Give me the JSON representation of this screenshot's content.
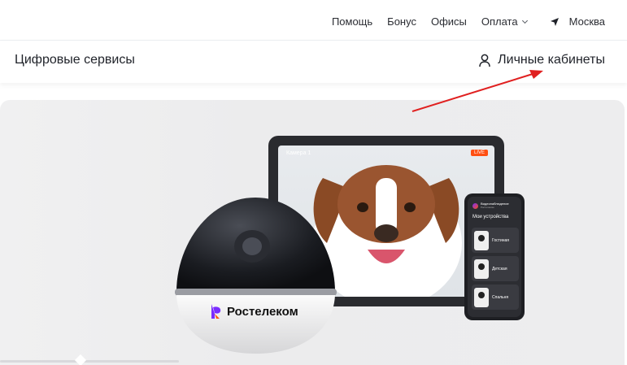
{
  "topnav": {
    "help": "Помощь",
    "bonus": "Бонус",
    "offices": "Офисы",
    "payment": "Оплата",
    "city": "Москва"
  },
  "header": {
    "title": "Цифровые сервисы",
    "cabinets": "Личные кабинеты"
  },
  "annotation": {
    "arrow_color": "#e02020"
  },
  "banner": {
    "tablet": {
      "camera_label": "Камера 1",
      "live_badge": "LIVE"
    },
    "phone": {
      "app_name": "Видеонаблюдение",
      "app_sub": "Ростелеком",
      "title": "Мои устройства",
      "devices": [
        "Гостиная",
        "Детская",
        "Спальня"
      ]
    },
    "camera_logo": "Ростелеком",
    "brand_color": "#7a2cff",
    "accent_color": "#ff4f12"
  }
}
